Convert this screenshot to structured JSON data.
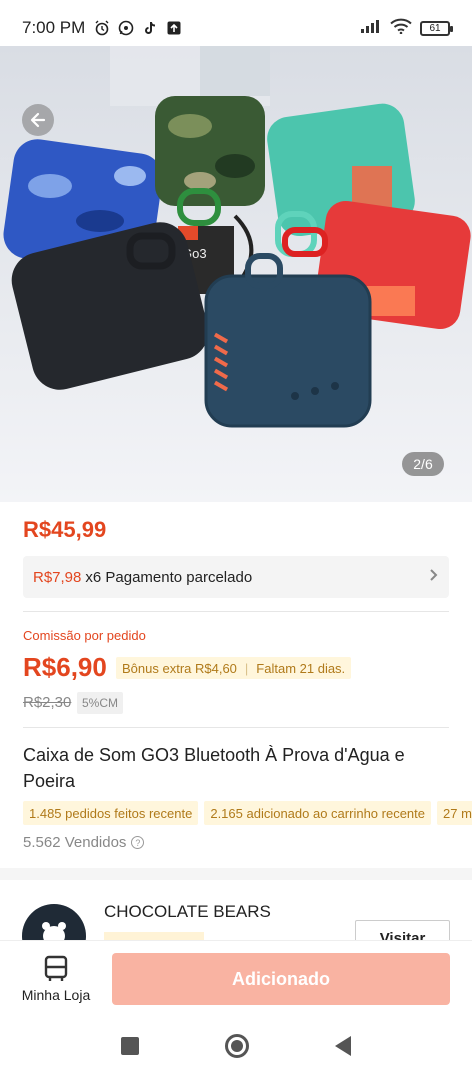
{
  "status_bar": {
    "time": "7:00 PM",
    "battery": "61",
    "icons": [
      "alarm-icon",
      "whatsapp-icon",
      "tiktok-icon",
      "upload-icon",
      "signal-icon",
      "wifi-icon",
      "battery-icon"
    ]
  },
  "gallery": {
    "page_indicator": "2/6",
    "product_label": "Go3"
  },
  "price": {
    "main": "R$45,99",
    "installment_amount": "R$7,98",
    "installment_text": "x6 Pagamento parcelado"
  },
  "commission": {
    "label": "Comissão por pedido",
    "value": "R$6,90",
    "bonus": "Bônus extra R$4,60",
    "remaining": "Faltam 21 dias.",
    "old_value": "R$2,30",
    "cm_tag": "5%CM"
  },
  "product": {
    "title": "Caixa de Som GO3 Bluetooth À Prova d'Agua e Poeira",
    "stats": [
      "1.485 pedidos feitos recente",
      "2.165 adicionado ao carrinho recente",
      "27 m"
    ],
    "sold": "5.562 Vendidos"
  },
  "shop": {
    "name": "CHOCOLATE BEARS",
    "visit_label": "Visitar"
  },
  "bottom_bar": {
    "my_store_label": "Minha Loja",
    "add_label": "Adicionado"
  },
  "colors": {
    "accent": "#e3461f",
    "add_button": "#f9b3a2",
    "tag_bg": "#fff6dc",
    "tag_text": "#b07a1a"
  }
}
